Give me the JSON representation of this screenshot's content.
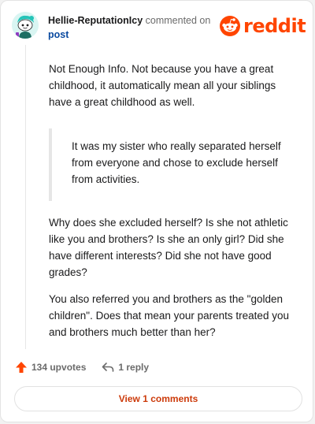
{
  "header": {
    "username": "Hellie-ReputationIcy",
    "action_text": "commented on",
    "post_link": "post",
    "brand": "reddit",
    "avatar_icon": "snoo-avatar-icon",
    "brand_icon": "reddit-alien-icon"
  },
  "comment": {
    "paragraph_1": "Not Enough Info. Not because you have a great childhood, it automatically mean all your siblings have a great childhood as well.",
    "quote": "It was my sister who really separated herself from everyone and chose to exclude herself from activities.",
    "paragraph_2": "Why does she excluded herself? Is she not athletic like you and brothers? Is she an only girl? Did she have different interests? Did she not have good grades?",
    "paragraph_3": "You also referred you and brothers as the \"golden children\". Does that mean your parents treated you and brothers much better than her?"
  },
  "footer": {
    "upvotes": "134 upvotes",
    "replies": "1 reply",
    "view_comments": "View 1 comments",
    "upvote_icon": "upvote-arrow-icon",
    "reply_icon": "reply-icon"
  },
  "colors": {
    "brand": "#ff4500",
    "link": "#0a4aa0",
    "view_button_text": "#cc3a0a",
    "text": "#1a1a1b",
    "muted": "#6b6b6b"
  }
}
